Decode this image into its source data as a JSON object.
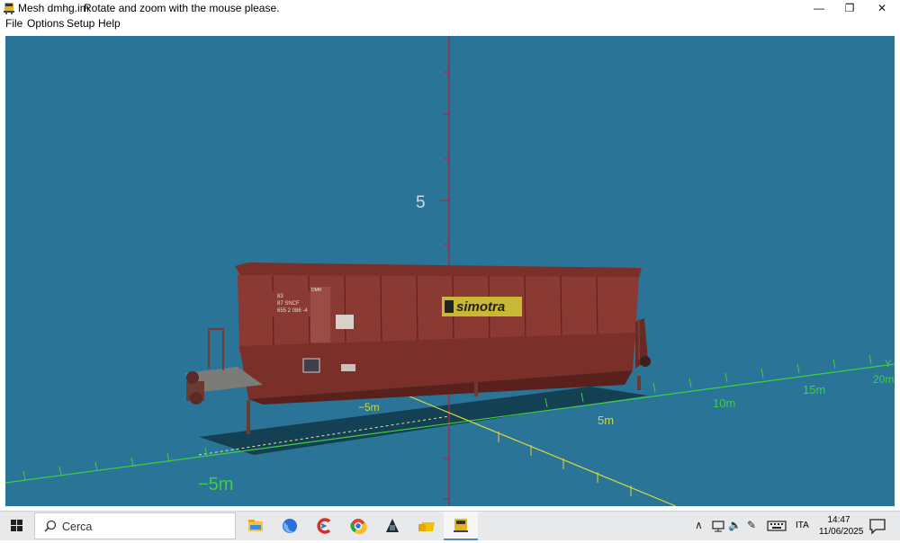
{
  "window": {
    "title": "Mesh dmhg.im",
    "hint": "Rotate and zoom with the mouse please.",
    "minimize_glyph": "—",
    "restore_glyph": "❐",
    "close_glyph": "✕"
  },
  "menu": {
    "file": "File",
    "options": "Options",
    "setup": "Setup",
    "help": "Help"
  },
  "viewport": {
    "background": "#2a7597",
    "z_label": "5",
    "y_axis_name": "Y",
    "x_neg_label": "−5m",
    "y_labels": [
      "−5m",
      "5m",
      "10m",
      "15m",
      "20m"
    ],
    "axis_colors": {
      "z": "#a02b3d",
      "y": "#3fcf3f",
      "x": "#d8d83a"
    }
  },
  "wagon": {
    "uic_number_lines": [
      "83",
      "87 SNCF",
      "655 2 086 -4"
    ],
    "brand": "simotra",
    "tag": "DMH",
    "body_color": "#8a3a32"
  },
  "taskbar": {
    "search_placeholder": "Cerca",
    "language": "ITA",
    "time": "14:47",
    "date": "11/06/2025",
    "apps": [
      "file-explorer",
      "firefox",
      "ccleaner",
      "chrome",
      "app-dark",
      "folder-yellow",
      "mesh-viewer"
    ]
  }
}
